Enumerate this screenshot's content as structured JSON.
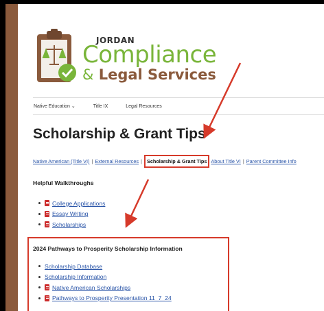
{
  "logo": {
    "top": "JORDAN",
    "main": "Compliance",
    "amp": "&",
    "sub": "Legal Services"
  },
  "nav": {
    "items": [
      "Native Education ⌄",
      "Title IX",
      "Legal Resources"
    ]
  },
  "page_title": "Scholarship & Grant Tips",
  "sublinks": {
    "items": [
      "Native American (Title VI)",
      "External Resources",
      "Scholarship & Grant Tips",
      "About Title VI",
      "Parent Committee Info"
    ],
    "separator": "|"
  },
  "walkthroughs": {
    "heading": "Helpful Walkthroughs",
    "items": [
      "College Applications",
      "Essay Writing",
      "Scholarships"
    ]
  },
  "pathways": {
    "heading": "2024 Pathways to Prosperity Scholarship Information",
    "items": [
      "Scholarship Database",
      "Scholarship Information",
      "Native American Scholarships",
      "Pathways to Prosperity Presentation 11_7_24"
    ]
  },
  "colors": {
    "brand_green": "#79b53a",
    "brand_brown": "#8a5a3c",
    "highlight_red": "#d63a2a",
    "link_blue": "#2a55a8"
  },
  "icons": [
    "pdf-icon",
    "scales-icon",
    "checkmark-icon",
    "clipboard-icon"
  ]
}
